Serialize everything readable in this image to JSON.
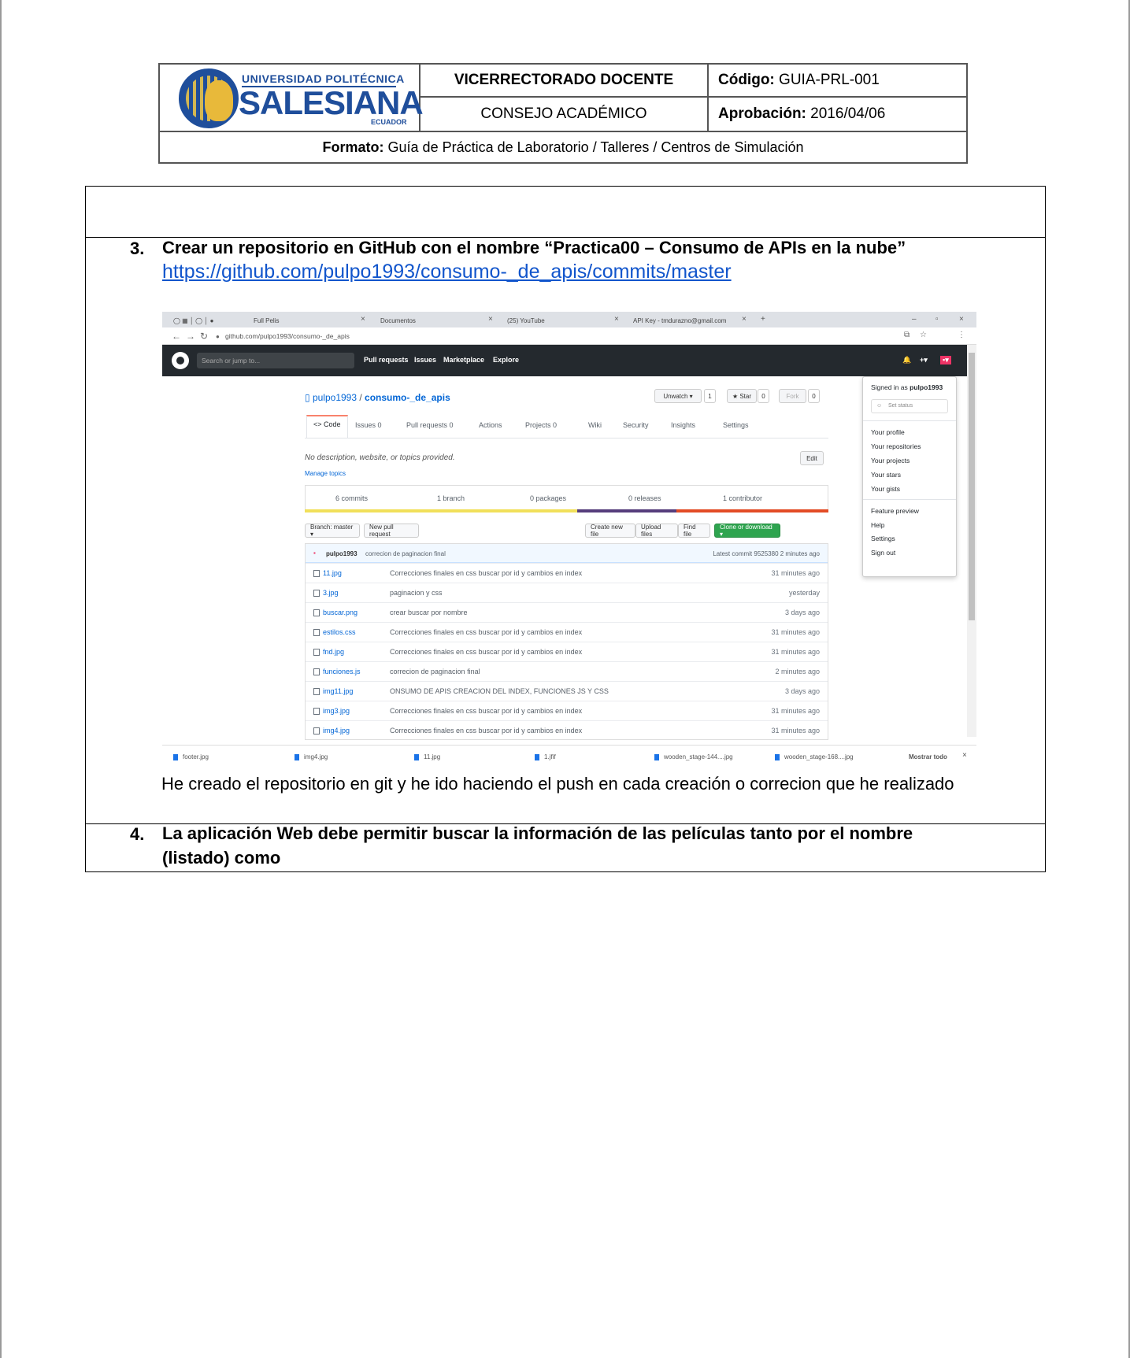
{
  "header": {
    "logo_line1": "UNIVERSIDAD POLITÉCNICA",
    "logo_line2": "SALESIANA",
    "logo_line3": "ECUADOR",
    "vicerrectorado": "VICERRECTORADO DOCENTE",
    "consejo": "CONSEJO ACADÉMICO",
    "codigo_label": "Código:",
    "codigo_value": "GUIA-PRL-001",
    "aprobacion_label": "Aprobación:",
    "aprobacion_value": "2016/04/06",
    "formato_label": "Formato:",
    "formato_value": "Guía de Práctica de Laboratorio / Talleres / Centros de Simulación"
  },
  "items": [
    {
      "number": "3.",
      "text": "Crear un repositorio en GitHub con el nombre “Practica00 – Consumo de APIs en la nube”"
    },
    {
      "number": "4.",
      "text_line1": "La aplicación Web debe permitir buscar la información de las películas tanto por el nombre",
      "text_line2": "(listado) como"
    }
  ],
  "repo_link": "https://github.com/pulpo1993/consumo-_de_apis/commits/master",
  "paragraph": "He creado el repositorio en git y he ido haciendo el push en cada creación o correcion que he realizado",
  "screenshot": {
    "tabs": [
      "Full Pelis",
      "Documentos",
      "(25) YouTube",
      "API Key - tmdurazno@gmail.com"
    ],
    "address": "github.com/pulpo1993/consumo-_de_apis",
    "search_placeholder": "Search or jump to...",
    "nav": [
      "Pull requests",
      "Issues",
      "Marketplace",
      "Explore"
    ],
    "repo_owner": "pulpo1993",
    "repo_sep": "/",
    "repo_name": "consumo-_de_apis",
    "unwatch": "Unwatch ▾",
    "unwatch_count": "1",
    "star": "★ Star",
    "star_count": "0",
    "fork": "Fork",
    "fork_count": "0",
    "repo_tabs": [
      "<> Code",
      "Issues 0",
      "Pull requests 0",
      "Actions",
      "Projects 0",
      "Wiki",
      "Security",
      "Insights",
      "Settings"
    ],
    "description": "No description, website, or topics provided.",
    "edit": "Edit",
    "manage_topics": "Manage topics",
    "numbers": [
      "6 commits",
      "1 branch",
      "0 packages",
      "0 releases",
      "1 contributor"
    ],
    "branch_btn": "Branch: master ▾",
    "new_pr": "New pull request",
    "create_file": "Create new file",
    "upload": "Upload files",
    "find": "Find file",
    "clone": "Clone or download ▾",
    "latest_commit_author": "pulpo1993",
    "latest_commit_msg": "correcion de paginacion final",
    "latest_commit_info": "Latest commit 9525380 2 minutes ago",
    "files": [
      {
        "name": "11.jpg",
        "msg": "Correcciones finales en css buscar por id y cambios en index",
        "age": "31 minutes ago"
      },
      {
        "name": "3.jpg",
        "msg": "paginacion y css",
        "age": "yesterday"
      },
      {
        "name": "buscar.png",
        "msg": "crear buscar por nombre",
        "age": "3 days ago"
      },
      {
        "name": "estilos.css",
        "msg": "Correcciones finales en css buscar por id y cambios en index",
        "age": "31 minutes ago"
      },
      {
        "name": "fnd.jpg",
        "msg": "Correcciones finales en css buscar por id y cambios en index",
        "age": "31 minutes ago"
      },
      {
        "name": "funciones.js",
        "msg": "correcion de paginacion final",
        "age": "2 minutes ago"
      },
      {
        "name": "img11.jpg",
        "msg": "ONSUMO DE APIS CREACION DEL INDEX, FUNCIONES JS Y CSS",
        "age": "3 days ago"
      },
      {
        "name": "img3.jpg",
        "msg": "Correcciones finales en css buscar por id y cambios en index",
        "age": "31 minutes ago"
      },
      {
        "name": "img4.jpg",
        "msg": "Correcciones finales en css buscar por id y cambios en index",
        "age": "31 minutes ago"
      }
    ],
    "dropdown": {
      "signed_in": "Signed in as",
      "user": "pulpo1993",
      "set_status": "Set status",
      "items_a": [
        "Your profile",
        "Your repositories",
        "Your projects",
        "Your stars",
        "Your gists"
      ],
      "items_b": [
        "Feature preview",
        "Help",
        "Settings",
        "Sign out"
      ]
    },
    "downloads": [
      "footer.jpg",
      "img4.jpg",
      "11.jpg",
      "1.jfif",
      "wooden_stage-144....jpg",
      "wooden_stage-168....jpg"
    ],
    "show_all": "Mostrar todo"
  }
}
